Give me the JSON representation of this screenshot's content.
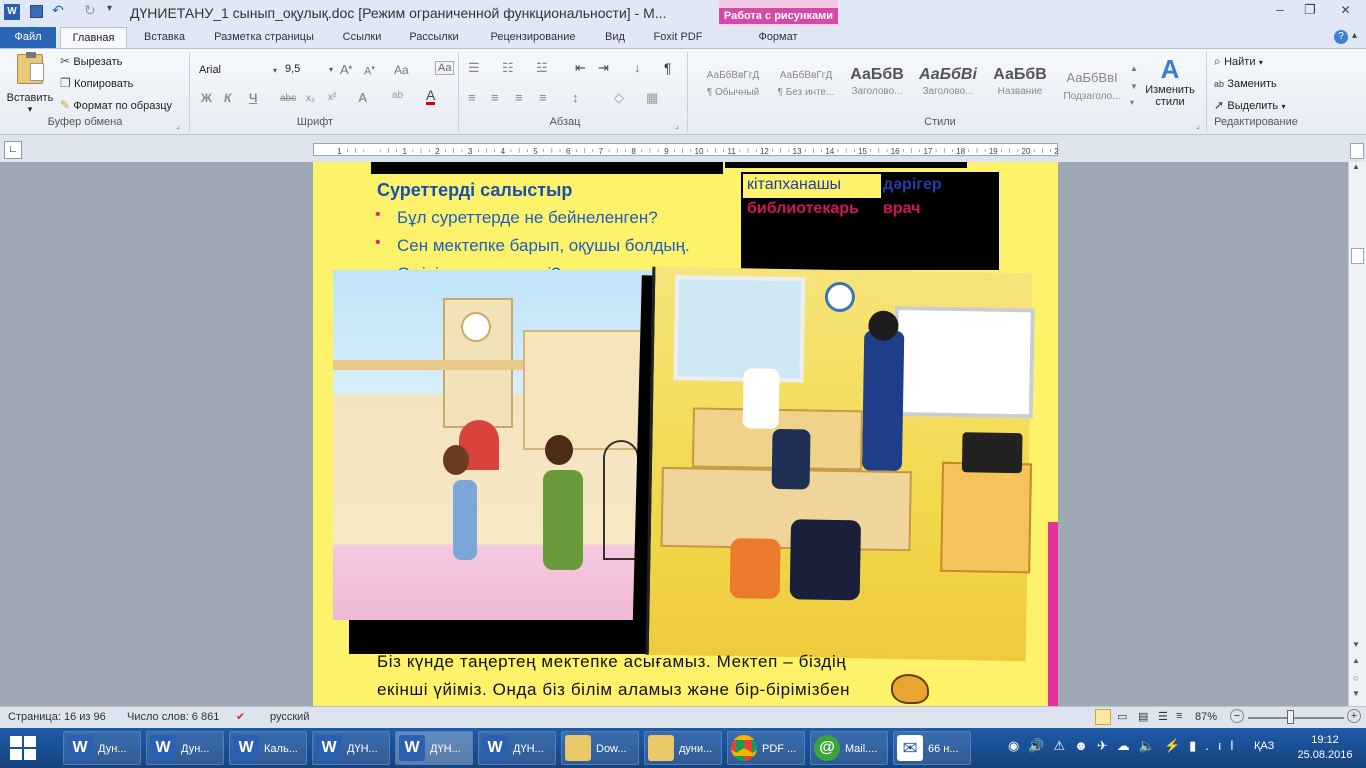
{
  "window": {
    "title": "ДҮНИЕТАНУ_1 сынып_оқулық.doc [Режим ограниченной функциональности]  -  M...",
    "context_tab_group": "Работа с рисунками"
  },
  "tabs": [
    "Файл",
    "Главная",
    "Вставка",
    "Разметка страницы",
    "Ссылки",
    "Рассылки",
    "Рецензирование",
    "Вид",
    "Foxit PDF",
    "Формат"
  ],
  "clipboard": {
    "paste": "Вставить",
    "cut": "Вырезать",
    "copy": "Копировать",
    "format_painter": "Формат по образцу",
    "group": "Буфер обмена"
  },
  "font": {
    "name": "Arial",
    "size": "9,5",
    "group": "Шрифт"
  },
  "paragraph": {
    "group": "Абзац"
  },
  "styles": {
    "items": [
      {
        "sample": "АаБбВвГгД",
        "name": "¶ Обычный"
      },
      {
        "sample": "АаБбВвГгД",
        "name": "¶ Без инте..."
      },
      {
        "sample": "АаБбВ",
        "name": "Заголово..."
      },
      {
        "sample": "АаБбВі",
        "name": "Заголово..."
      },
      {
        "sample": "АаБбВ",
        "name": "Название"
      },
      {
        "sample": "АаБбВвІ",
        "name": "Подзаголо..."
      }
    ],
    "change": "Изменить стили",
    "group": "Стили"
  },
  "editing": {
    "find": "Найти",
    "replace": "Заменить",
    "select": "Выделить",
    "group": "Редактирование"
  },
  "document": {
    "heading": "Суреттерді салыстыр",
    "bullets": [
      "Бұл суреттерде не бейнеленген?",
      "Сен мектепке барып, оқушы болдың."
    ],
    "line3": "Өмірінде не өзгерді?",
    "word1_kz": "кітапханашы",
    "word1_ru": "библиотекарь",
    "word2_kz": "дәрігер",
    "word2_ru": "врач",
    "para_line1": "Біз күнде таңертең мектепке асығамыз. Мектеп – біздің",
    "para_line2": "екінші үйіміз. Онда біз білім аламыз және бір-бірімізбен"
  },
  "status": {
    "page": "Страница: 16 из 96",
    "words": "Число слов: 6 861",
    "lang": "русский",
    "zoom": "87%"
  },
  "taskbar": {
    "items": [
      "Дун...",
      "Дун...",
      "Каль...",
      "ДҮН...",
      "ДҮН...",
      "ДҮН...",
      "Dow...",
      "дуни...",
      "PDF ...",
      "Mail....",
      "66 н..."
    ],
    "lang": "ҚАЗ",
    "time": "19:12",
    "date": "25.08.2016"
  }
}
